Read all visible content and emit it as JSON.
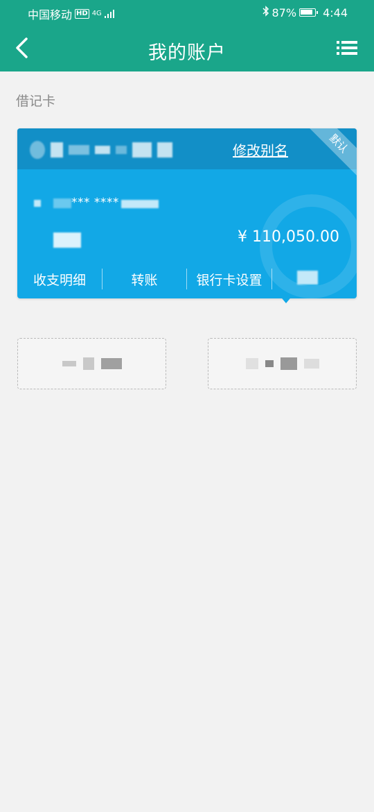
{
  "status_bar": {
    "carrier": "中国移动",
    "network_badge": "HD",
    "network_type": "4G",
    "battery": "87%",
    "time": "4:44",
    "icons": [
      "bluetooth-icon",
      "battery-icon",
      "signal-icon"
    ]
  },
  "header": {
    "title": "我的账户",
    "back_icon": "chevron-left-icon",
    "menu_icon": "list-menu-icon"
  },
  "section": {
    "label": "借记卡"
  },
  "card": {
    "alias_link": "修改别名",
    "default_badge": "默认",
    "masked_number": "*** ****",
    "balance": "¥ 110,050.00",
    "actions": [
      "收支明细",
      "转账",
      "银行卡设置"
    ]
  },
  "colors": {
    "header_bg": "#1aa68a",
    "card_bg": "#12a8e6",
    "card_top_bg": "#128fc7",
    "page_bg": "#f2f2f2"
  }
}
